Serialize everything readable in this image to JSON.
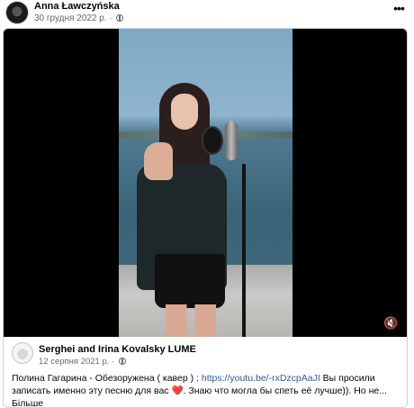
{
  "post": {
    "author": "Anna Ławczyńska",
    "date": "30 грудня 2022 р.",
    "separator": " · ",
    "more_label": "•••"
  },
  "shared": {
    "author": "Serghei and Irina Kovalsky LUME",
    "date": "12 серпня 2021 р.",
    "separator": " · ",
    "text_before_link": "Полина Гагарина - Обезоружена ( кавер ) : ",
    "link": "https://youtu.be/-rxDzcpAaJI",
    "text_after_link": " Вы просили записать именно эту песню для вас ",
    "heart": "❤️",
    "text_tail": ". Знаю что могла бы спеть её лучше)). Но не...",
    "see_more": "Більше"
  },
  "icons": {
    "mute": "🔇"
  }
}
